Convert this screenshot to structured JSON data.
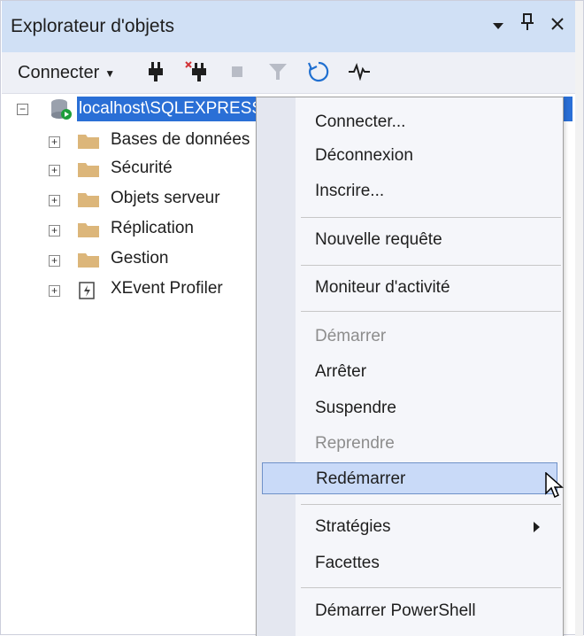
{
  "panel": {
    "title": "Explorateur d'objets",
    "pin_symbol": "&#x2195;",
    "close_symbol": "×"
  },
  "toolbar": {
    "connect_label": "Connecter"
  },
  "tree": {
    "root": "localhost\\SQLEXPRESS",
    "items": [
      {
        "label": "Bases de données"
      },
      {
        "label": "Sécurité"
      },
      {
        "label": "Objets serveur"
      },
      {
        "label": "Réplication"
      },
      {
        "label": "Gestion"
      },
      {
        "label": "XEvent Profiler"
      }
    ]
  },
  "context_menu": {
    "items": [
      {
        "label": "Connecter..."
      },
      {
        "label": "Déconnexion"
      },
      {
        "label": "Inscrire..."
      },
      {
        "label": "Nouvelle requête"
      },
      {
        "label": "Moniteur d'activité"
      },
      {
        "label": "Démarrer",
        "disabled": true
      },
      {
        "label": "Arrêter"
      },
      {
        "label": "Suspendre"
      },
      {
        "label": "Reprendre",
        "disabled": true
      },
      {
        "label": "Redémarrer",
        "highlighted": true
      },
      {
        "label": "Stratégies",
        "submenu": true
      },
      {
        "label": "Facettes"
      },
      {
        "label": "Démarrer PowerShell"
      }
    ]
  },
  "colors": {
    "selection": "#2a6fd6",
    "title_bg": "#d0e0f5",
    "hover_bg": "#c9daf8"
  }
}
